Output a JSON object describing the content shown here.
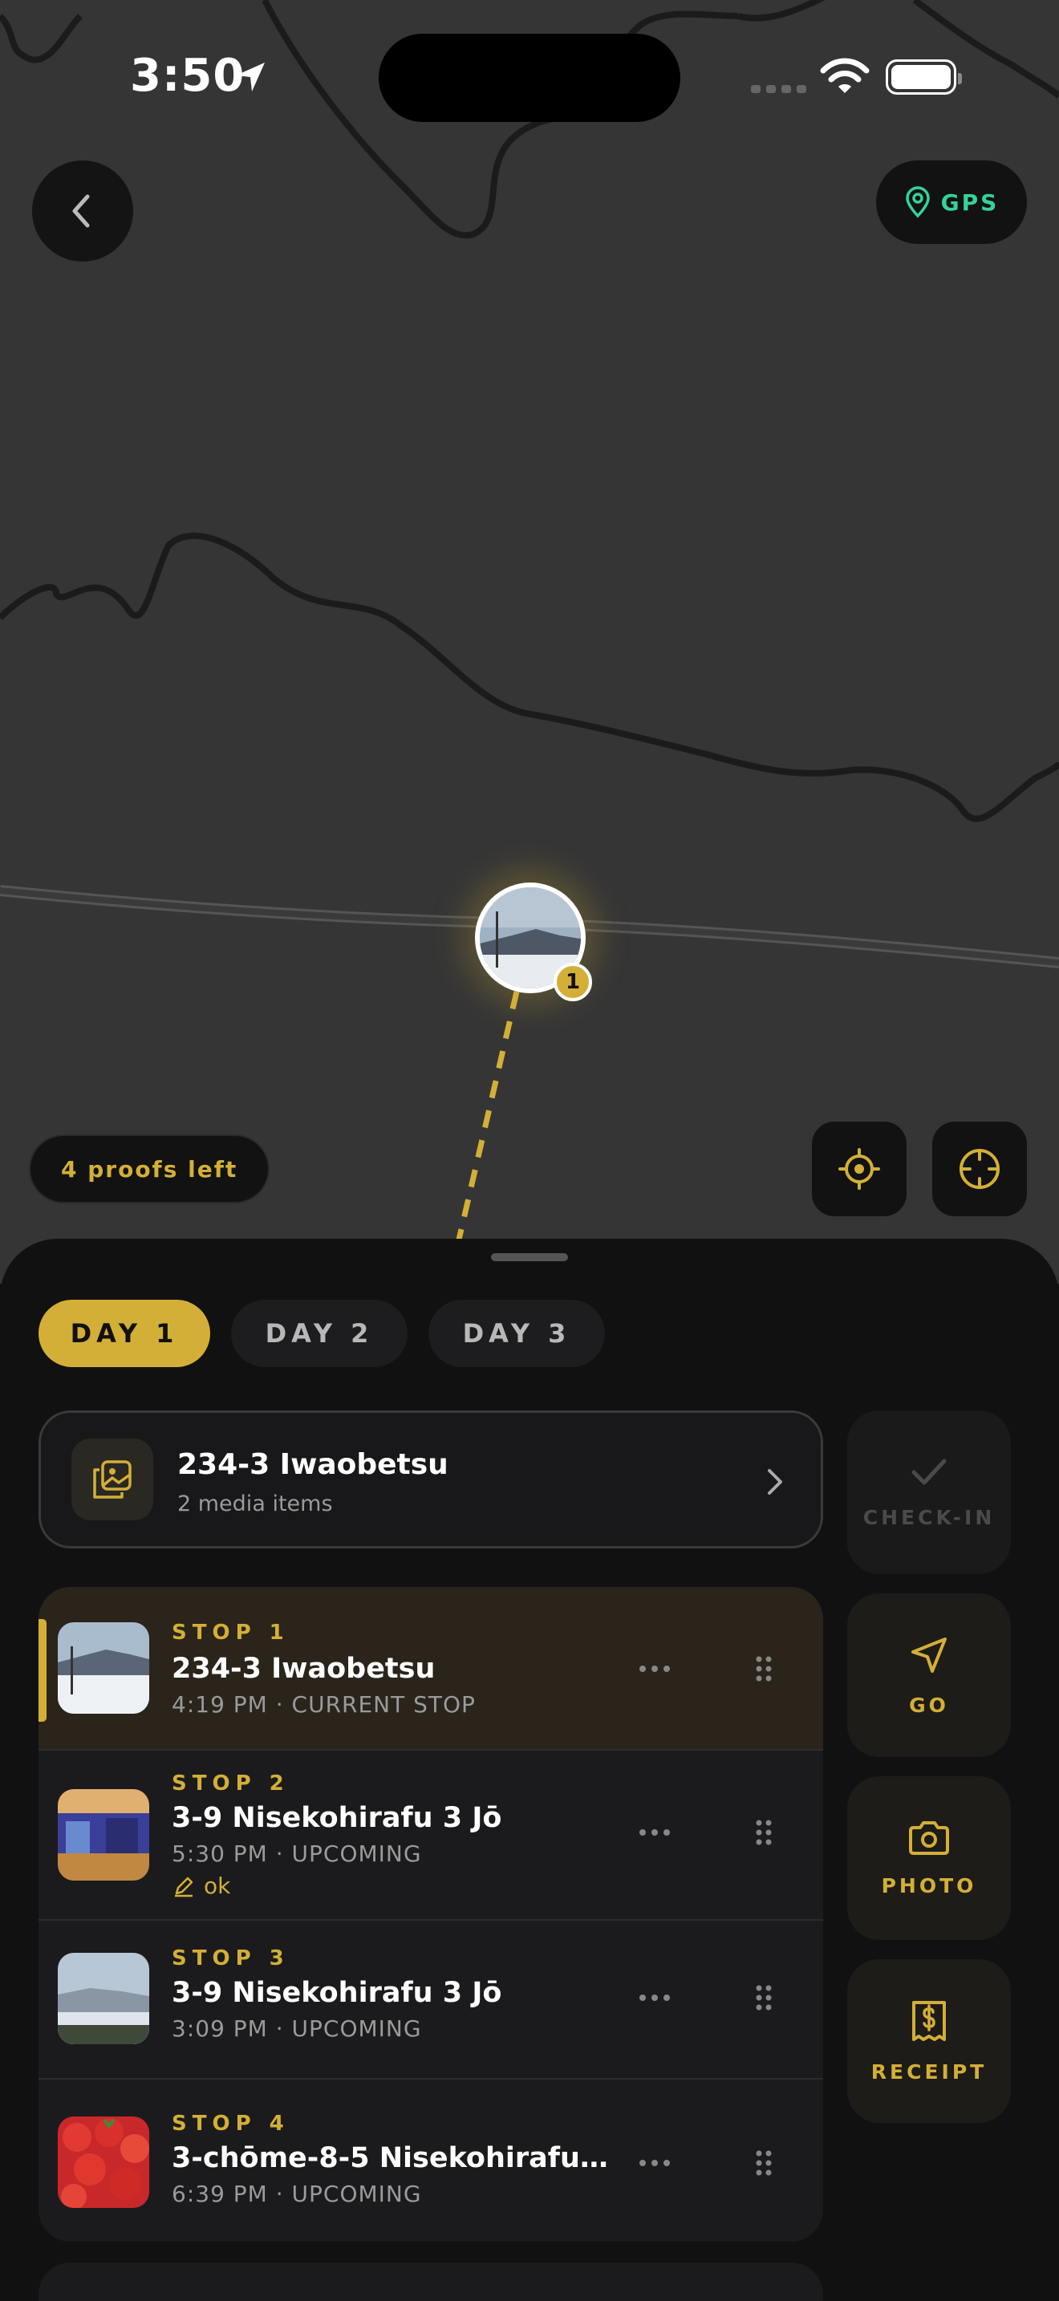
{
  "status_bar": {
    "time": "3:50"
  },
  "header": {
    "back_icon": "chevron-left-icon",
    "gps_label": "GPS",
    "gps_color": "#34d399"
  },
  "map": {
    "pin_badge": "1",
    "proofs_left": "4 proofs left",
    "route_color": "#d4af37"
  },
  "sheet": {
    "tabs": [
      {
        "label": "DAY 1",
        "active": true
      },
      {
        "label": "DAY 2",
        "active": false
      },
      {
        "label": "DAY 3",
        "active": false
      }
    ],
    "summary": {
      "title": "234-3 Iwaobetsu",
      "subtitle": "2 media items"
    },
    "stops": [
      {
        "label": "STOP 1",
        "name": "234-3 Iwaobetsu",
        "meta": "4:19 PM · CURRENT STOP",
        "current": true
      },
      {
        "label": "STOP 2",
        "name": "3-9 Nisekohirafu 3 Jō",
        "meta": "5:30 PM · UPCOMING",
        "note": "ok"
      },
      {
        "label": "STOP 3",
        "name": "3-9 Nisekohirafu 3 Jō",
        "meta": "3:09 PM · UPCOMING"
      },
      {
        "label": "STOP 4",
        "name": "3-chōme-8-5 Nisekohirafu…",
        "meta": "6:39 PM · UPCOMING"
      }
    ],
    "actions": {
      "checkin": "CHECK-IN",
      "go": "GO",
      "photo": "PHOTO",
      "receipt": "RECEIPT"
    }
  },
  "accent_color": "#d4af37"
}
